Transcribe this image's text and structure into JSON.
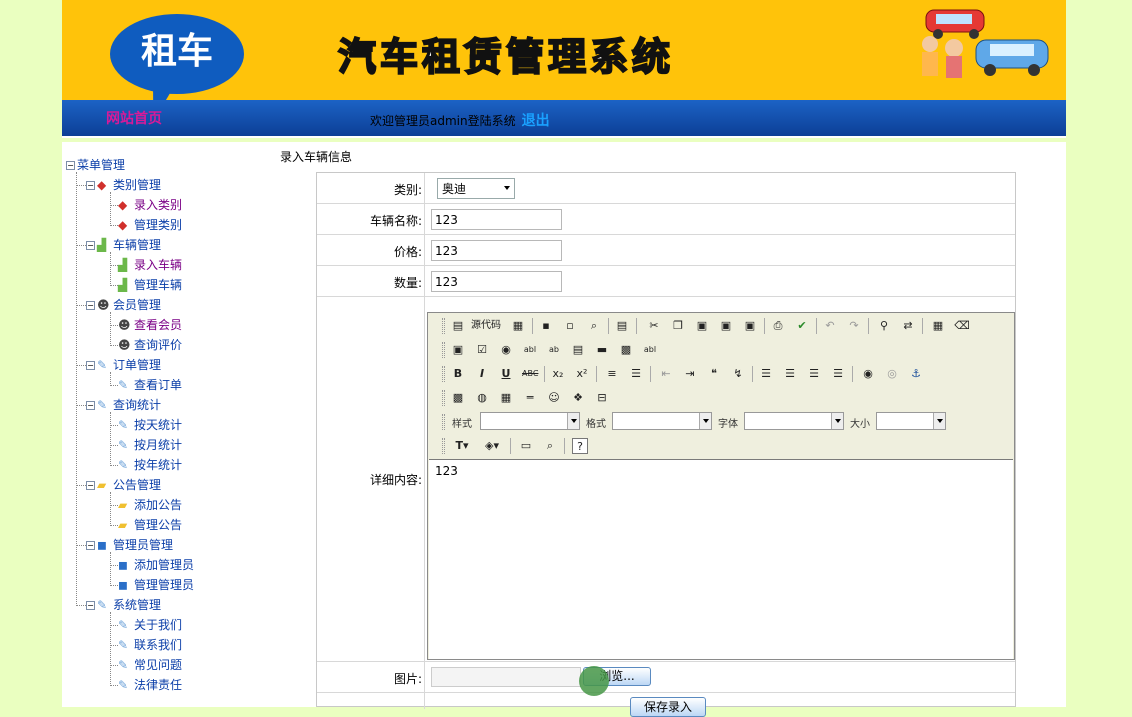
{
  "header": {
    "logo_text": "租车",
    "system_title": "汽车租赁管理系统",
    "home_link": "网站首页",
    "welcome": "欢迎管理员admin登陆系统",
    "logout": "退出"
  },
  "sidebar": {
    "root": "菜单管理",
    "groups": [
      {
        "label": "类别管理",
        "icon": "book-icon",
        "items": [
          "录入类别",
          "管理类别"
        ]
      },
      {
        "label": "车辆管理",
        "icon": "blocks-icon",
        "items": [
          "录入车辆",
          "管理车辆"
        ]
      },
      {
        "label": "会员管理",
        "icon": "users-icon",
        "items": [
          "查看会员",
          "查询评价"
        ]
      },
      {
        "label": "订单管理",
        "icon": "pen-icon",
        "items": [
          "查看订单"
        ]
      },
      {
        "label": "查询统计",
        "icon": "pen-icon",
        "items": [
          "按天统计",
          "按月统计",
          "按年统计"
        ]
      },
      {
        "label": "公告管理",
        "icon": "folder-icon",
        "items": [
          "添加公告",
          "管理公告"
        ]
      },
      {
        "label": "管理员管理",
        "icon": "cube-icon",
        "items": [
          "添加管理员",
          "管理管理员"
        ]
      },
      {
        "label": "系统管理",
        "icon": "pen-icon",
        "items": [
          "关于我们",
          "联系我们",
          "常见问题",
          "法律责任"
        ]
      }
    ]
  },
  "form": {
    "title": "录入车辆信息",
    "category_label": "类别:",
    "category_value": "奥迪",
    "name_label": "车辆名称:",
    "name_value": "123",
    "price_label": "价格:",
    "price_value": "123",
    "qty_label": "数量:",
    "qty_value": "123",
    "detail_label": "详细内容:",
    "detail_value": "123",
    "image_label": "图片:",
    "browse_label": "浏览...",
    "save_label": "保存录入"
  },
  "editor": {
    "source_label": "源代码",
    "style_label": "样式",
    "format_label": "格式",
    "font_label": "字体",
    "size_label": "大小"
  }
}
